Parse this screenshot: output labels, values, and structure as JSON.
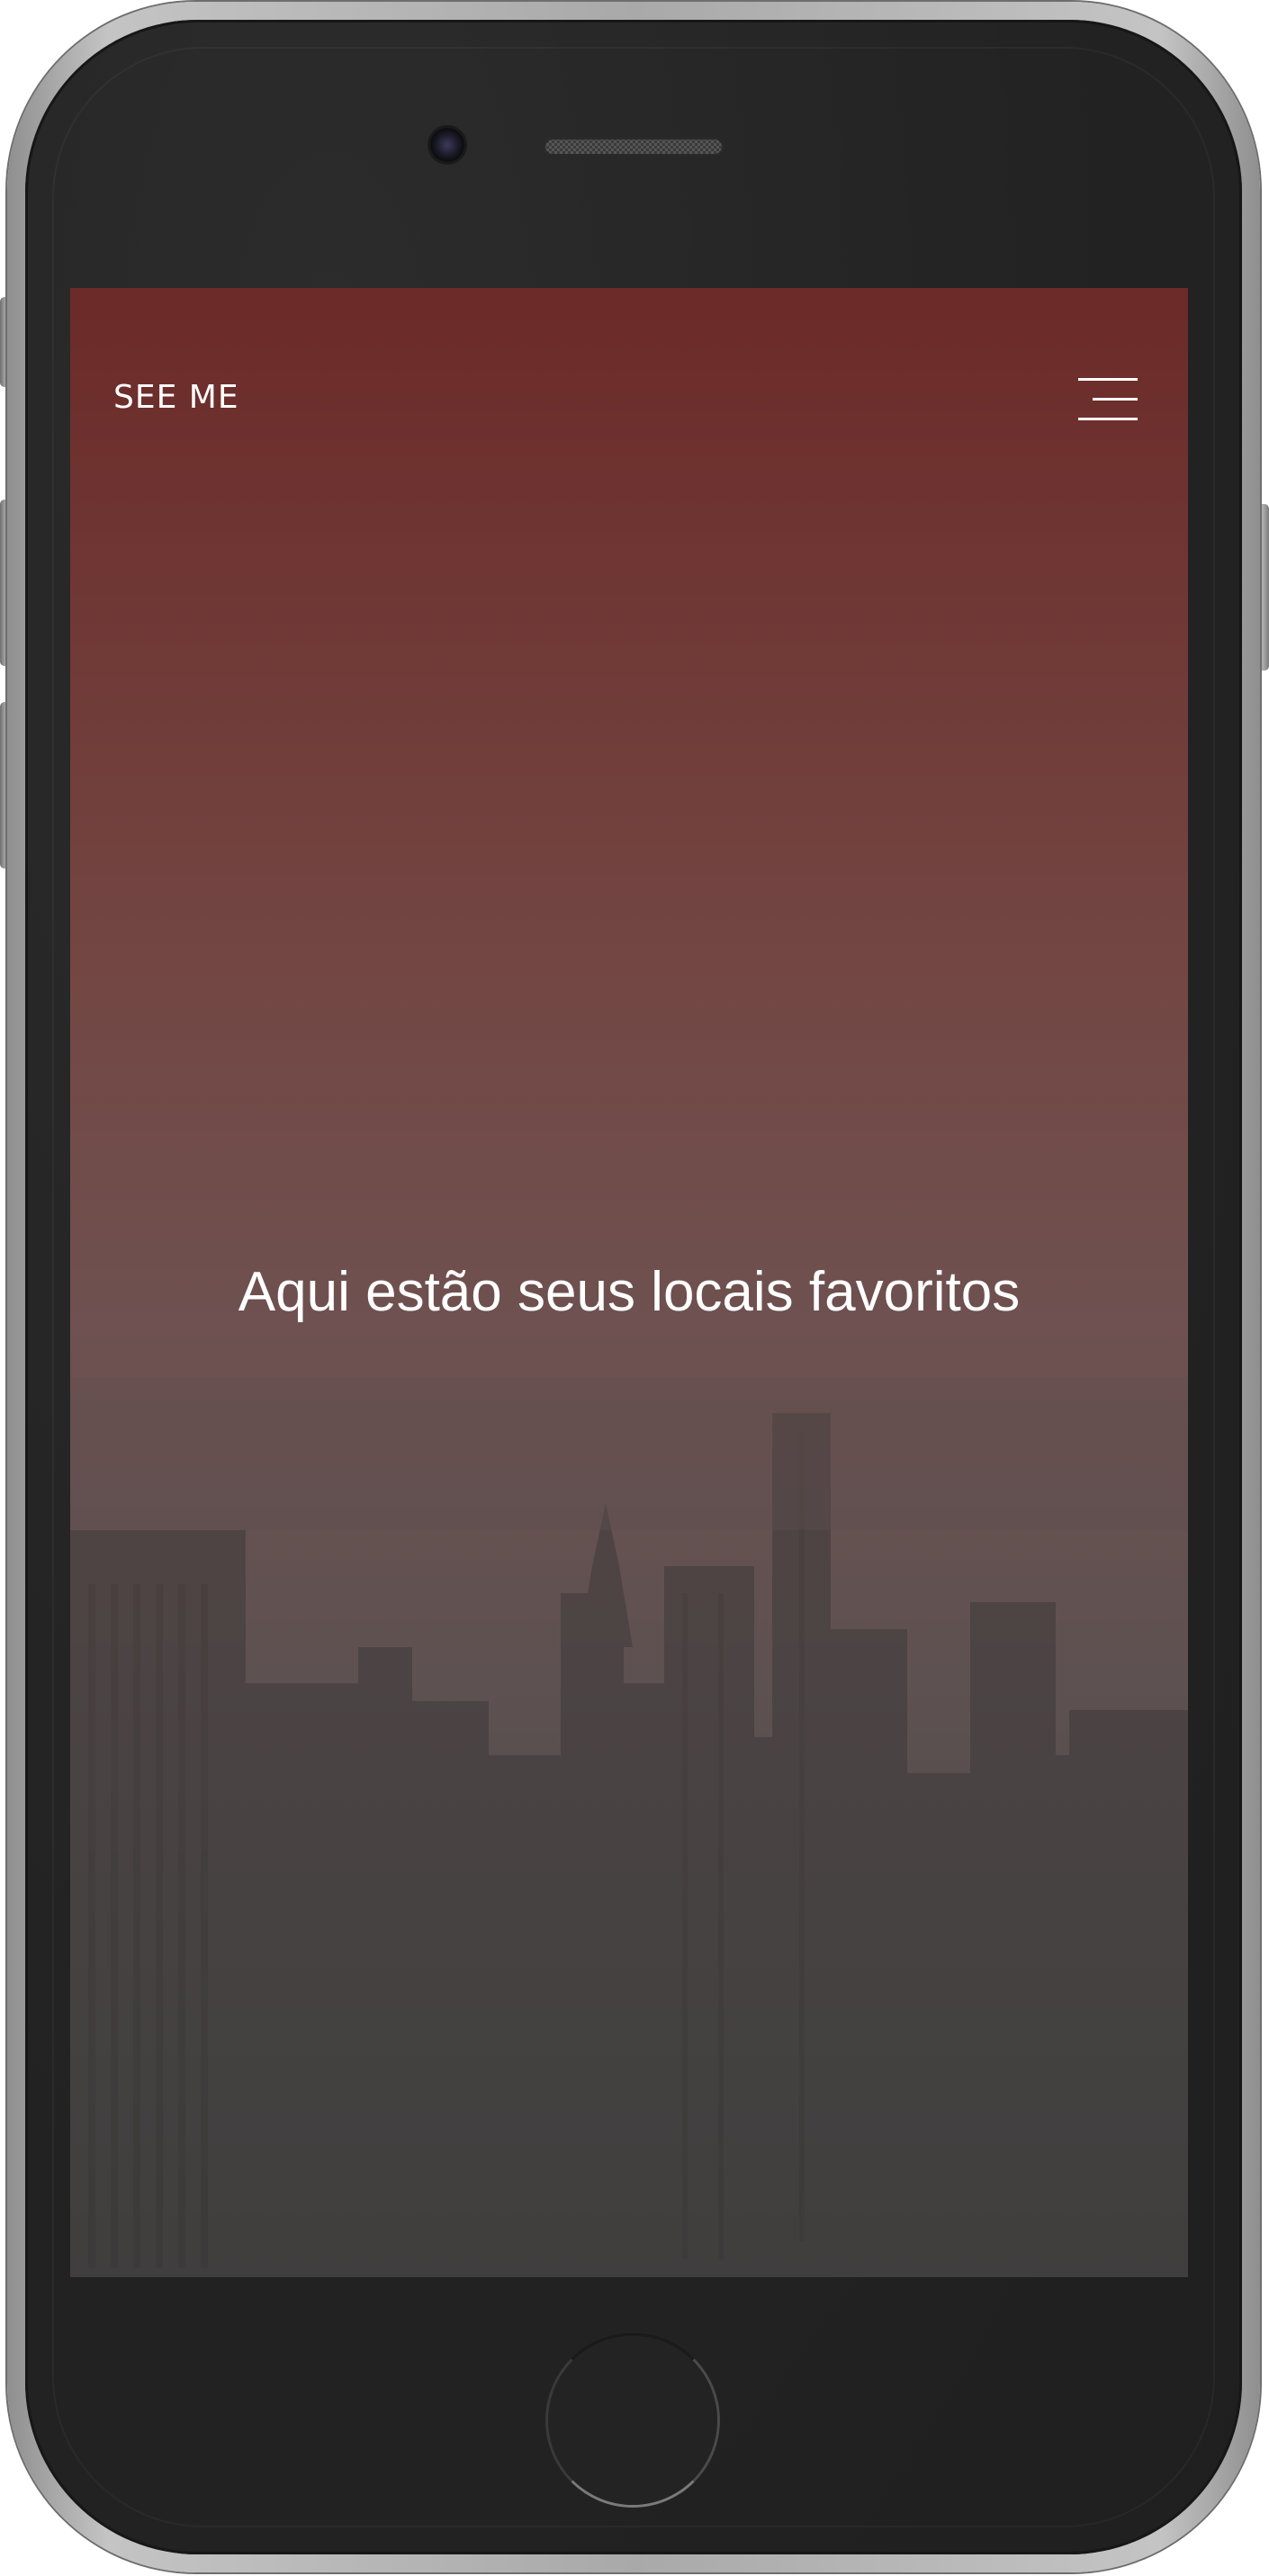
{
  "device": {
    "model": "iphone",
    "frame_color": "#b5b5b5",
    "body_color": "#242424"
  },
  "app": {
    "brand": "SEE ME",
    "menu_icon": "hamburger-icon",
    "headline": "Aqui estão seus locais favoritos",
    "background": {
      "type": "city-skyline-photo",
      "overlay_top_color": "#6c2a28",
      "overlay_bottom_color": "#444444"
    },
    "text_color": "#ffffff"
  }
}
